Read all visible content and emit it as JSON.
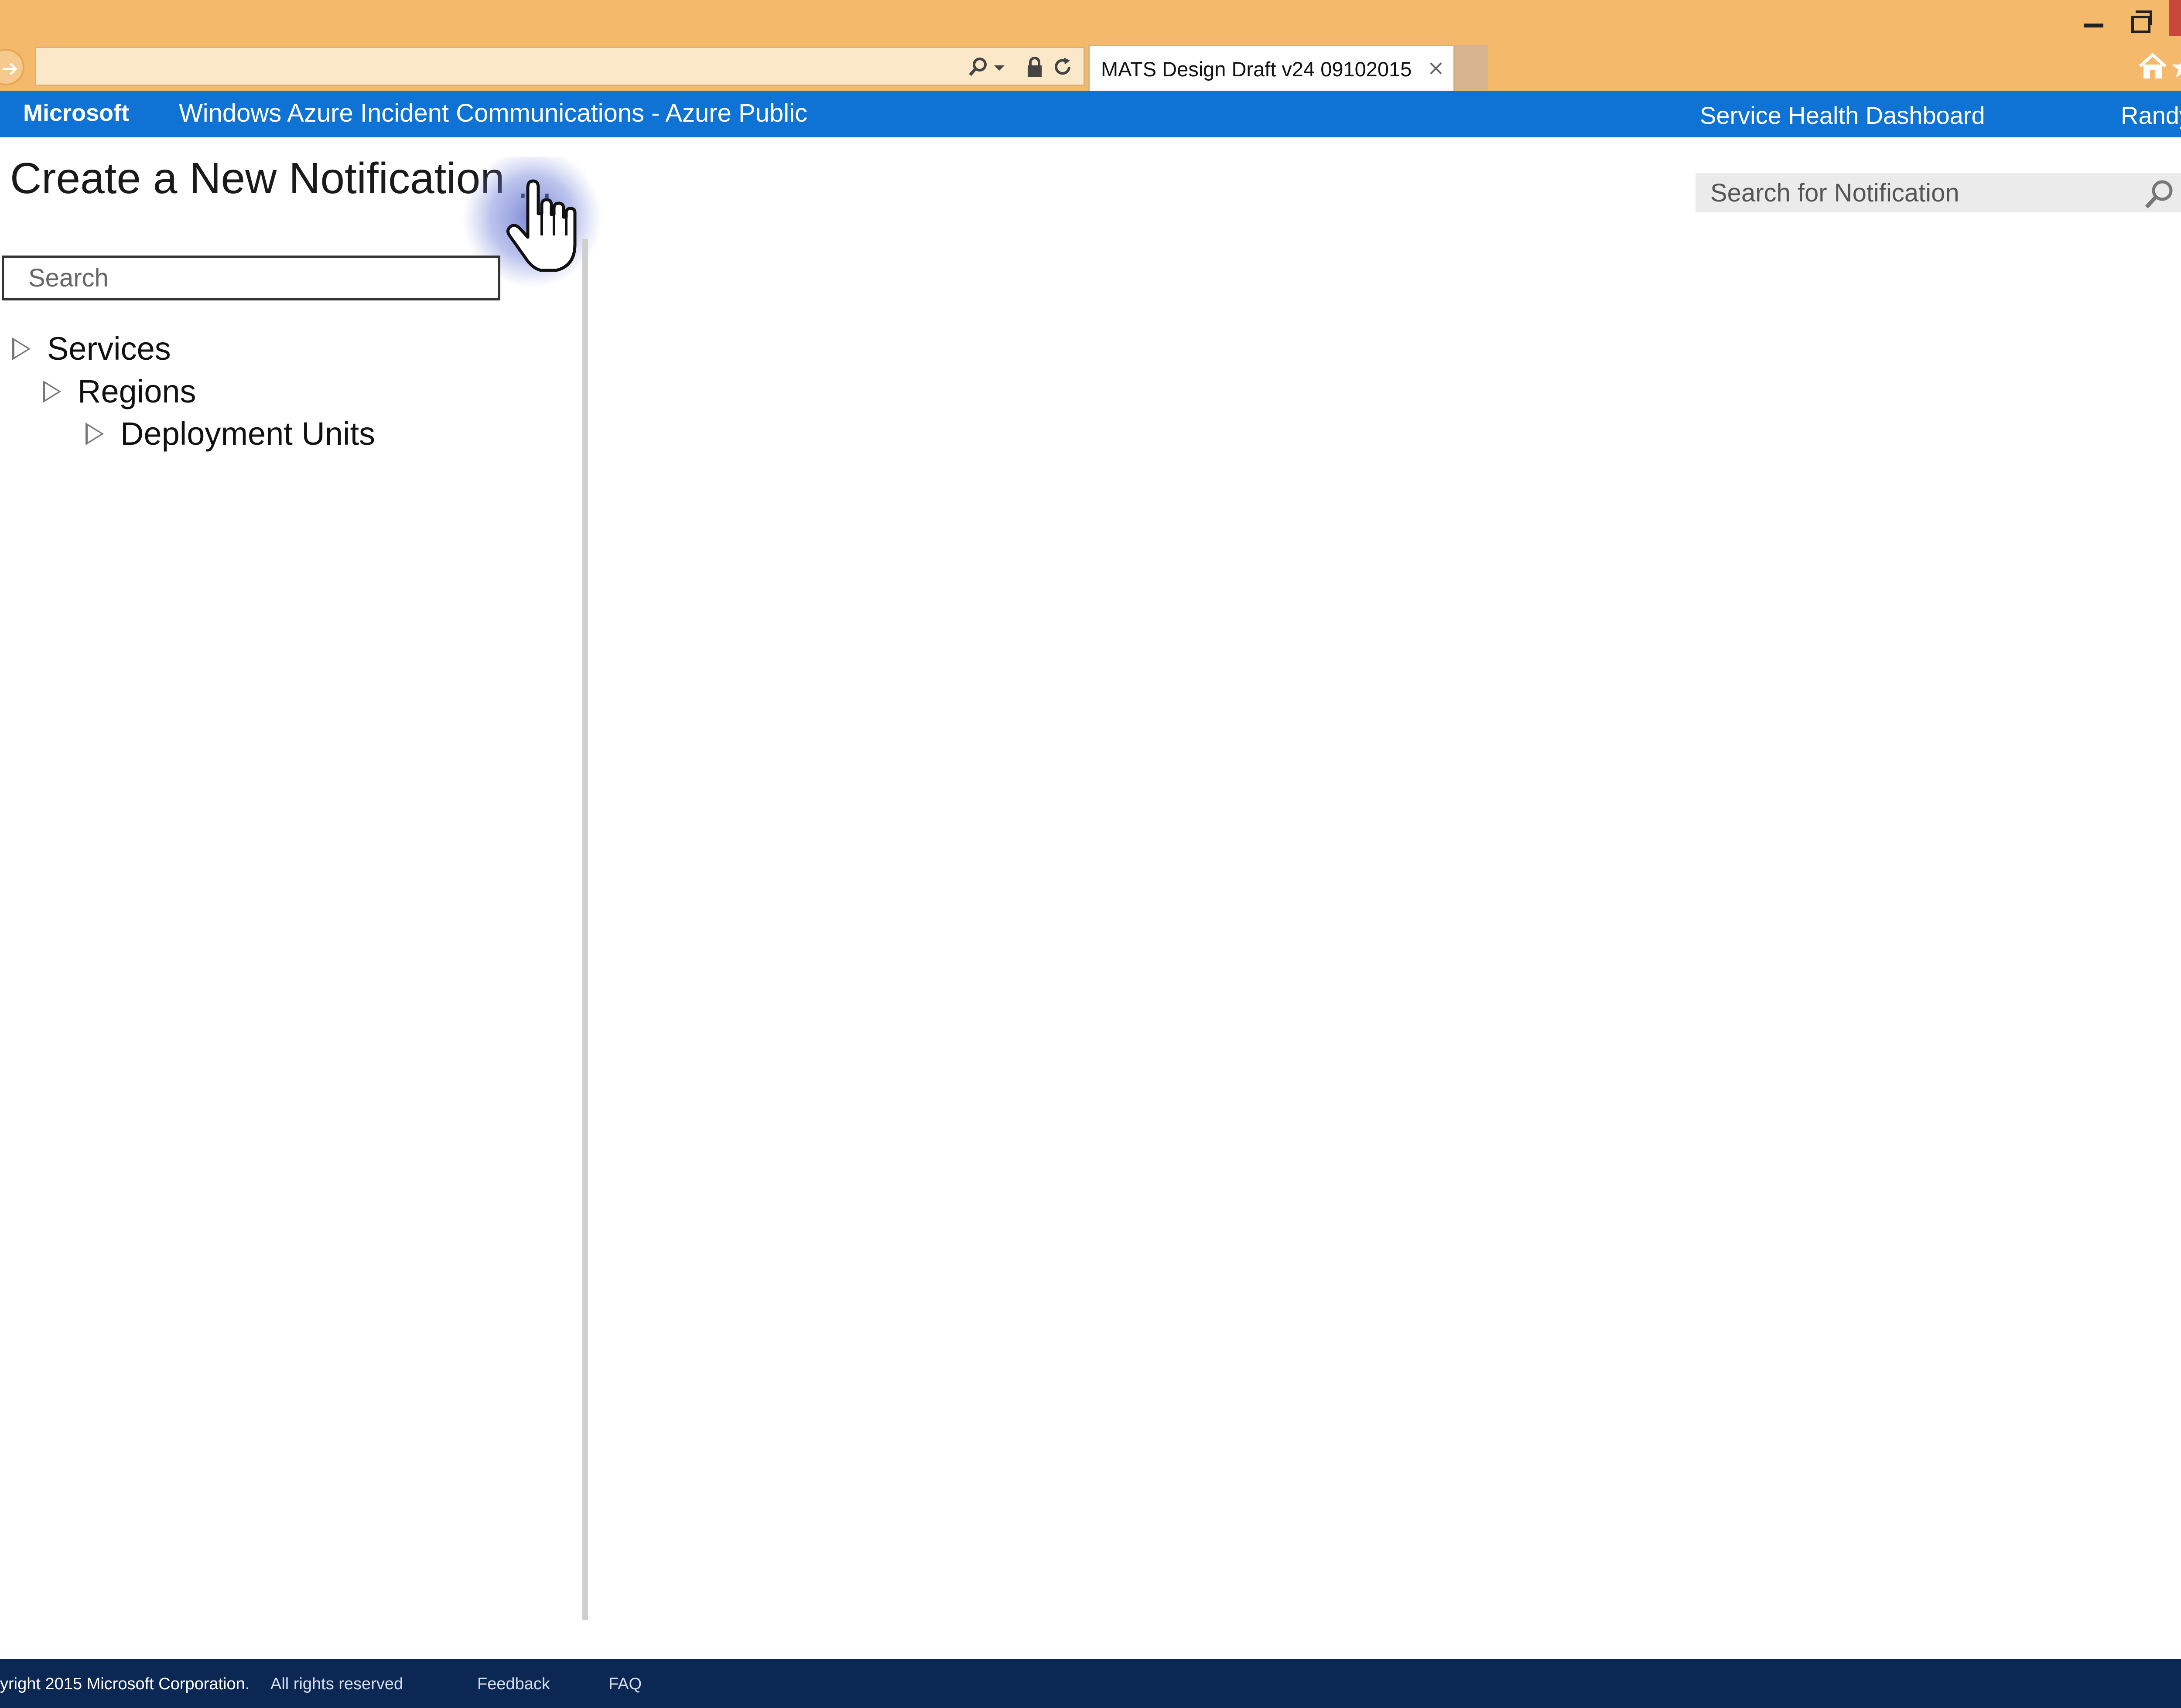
{
  "browser": {
    "address_value": "",
    "tab_title": "MATS Design Draft v24 09102015",
    "tab_close": "×",
    "chrome_color": "#f4b96a"
  },
  "topnav": {
    "brand": "Microsoft",
    "app_title": "Windows Azure Incident Communications - Azure Public",
    "dashboard_link": "Service Health Dashboard",
    "user": "Randy",
    "bg_color": "#0f73d6"
  },
  "page": {
    "title": "Create a New Notification",
    "more": "..."
  },
  "left_search": {
    "placeholder": "Search"
  },
  "tree": {
    "items": [
      {
        "label": "Services",
        "icon": "triangle-expand-icon"
      },
      {
        "label": "Regions",
        "icon": "triangle-expand-icon"
      },
      {
        "label": "Deployment Units",
        "icon": "triangle-expand-icon"
      }
    ]
  },
  "right_search": {
    "placeholder": "Search for Notification",
    "icon": "search-icon"
  },
  "footer": {
    "copyright": "yright 2015 Microsoft Corporation.",
    "rights": "All rights reserved",
    "feedback": "Feedback",
    "faq": "FAQ",
    "bg_color": "#0b2753"
  }
}
